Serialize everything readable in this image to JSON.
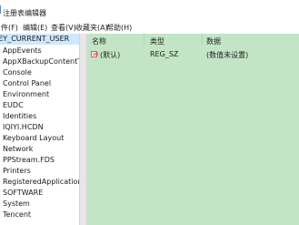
{
  "window": {
    "title": "注册表编辑器"
  },
  "menu": [
    "件(F)",
    "编辑(E)",
    "查看(V)",
    "收藏夹(A)",
    "帮助(H)"
  ],
  "tree": {
    "root": "KEY_CURRENT_USER",
    "items": [
      "AppEvents",
      "AppXBackupContentType",
      "Console",
      "Control Panel",
      "Environment",
      "EUDC",
      "Identities",
      "IQIYI.HCDN",
      "Keyboard Layout",
      "Network",
      "PPStream.FDS",
      "Printers",
      "RegisteredApplications",
      "SOFTWARE",
      "System",
      "Tencent"
    ]
  },
  "list": {
    "columns": [
      "名称",
      "类型",
      "数据"
    ],
    "rows": [
      {
        "icon": "string-value-icon",
        "name": "(默认)",
        "type": "REG_SZ",
        "data": "(数值未设置)"
      }
    ]
  },
  "colors": {
    "pane_bg": "#c3e5c6",
    "selection": "#cde8ff"
  }
}
